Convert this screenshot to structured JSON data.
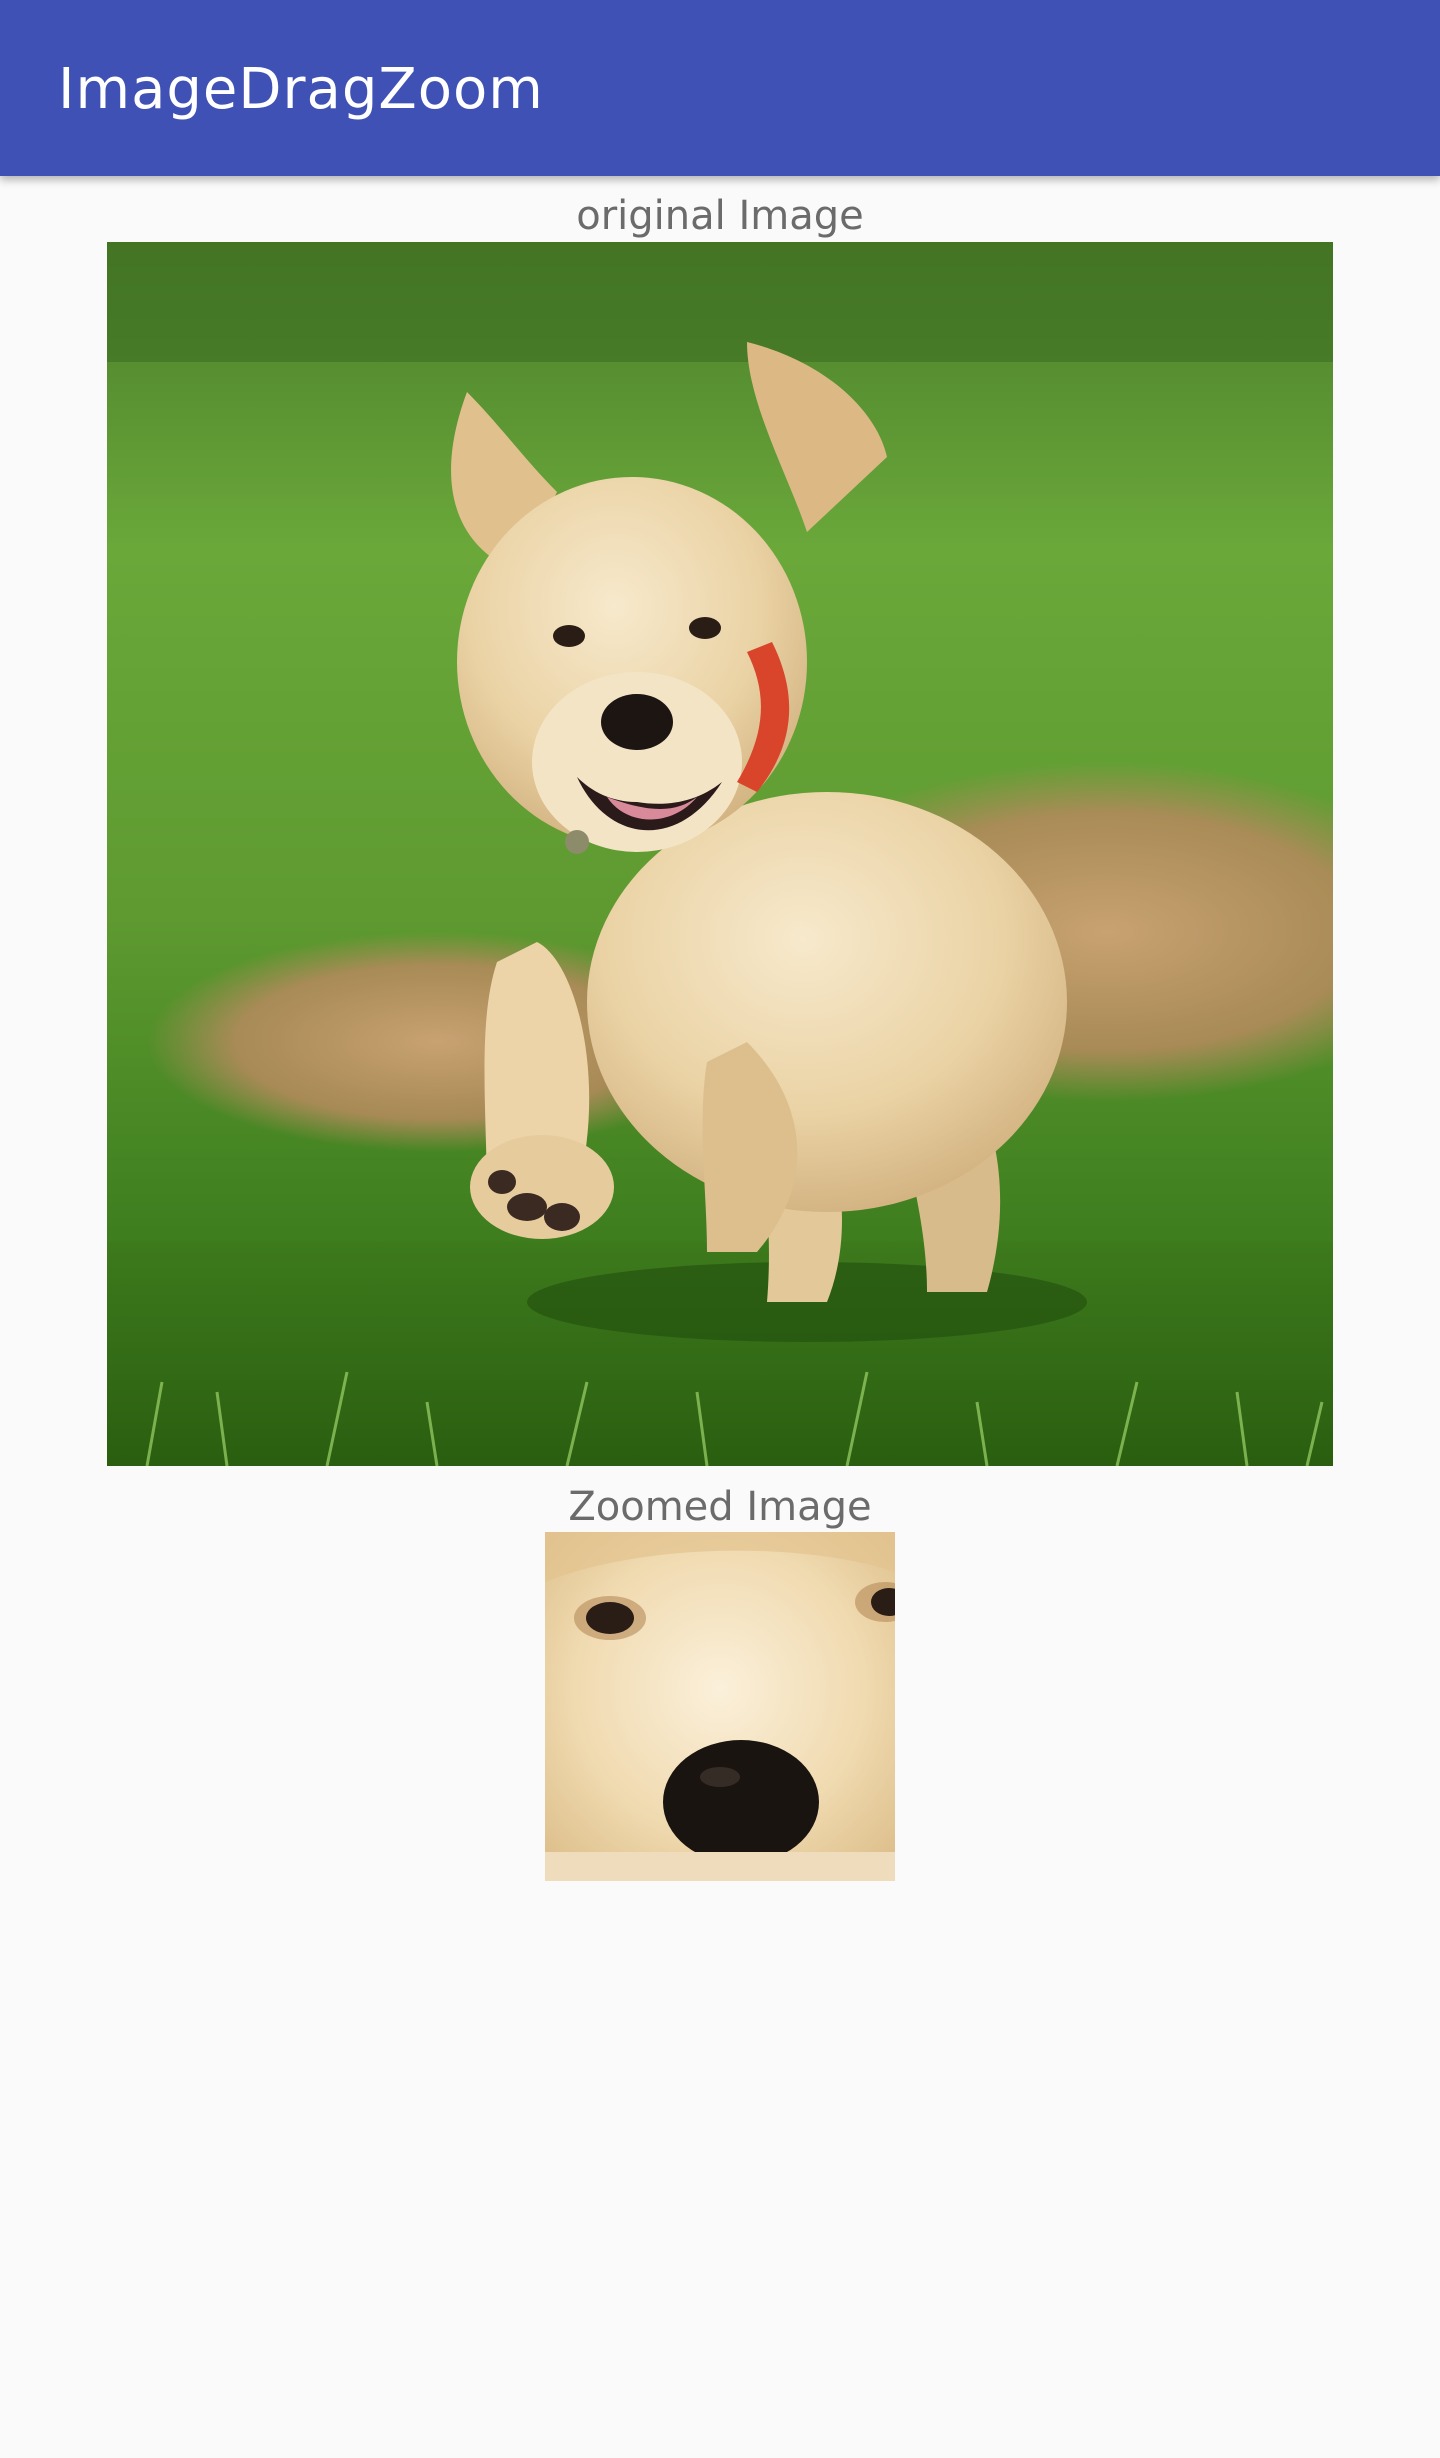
{
  "app_bar": {
    "title": "ImageDragZoom",
    "color": "#3f51b5"
  },
  "original_section": {
    "caption": "original Image",
    "image_subject": "puppy-running-on-grass"
  },
  "zoomed_section": {
    "caption": "Zoomed Image",
    "image_subject": "puppy-face-closeup"
  },
  "colors": {
    "background": "#fafafa",
    "caption_text": "#6b6b6b",
    "title_text": "#ffffff"
  }
}
